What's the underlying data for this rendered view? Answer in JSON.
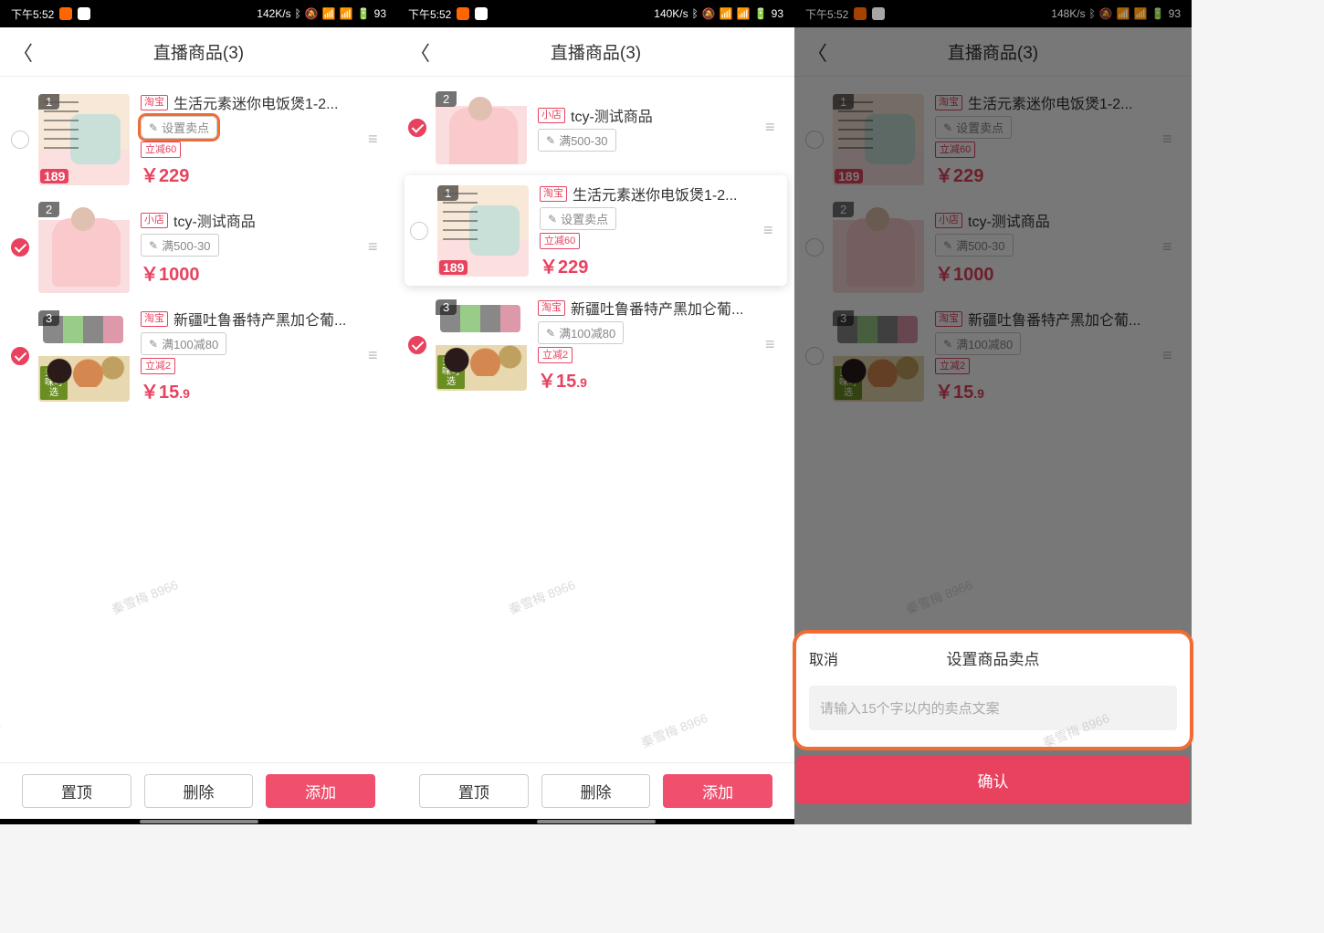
{
  "status": {
    "time": "下午5:52",
    "net1": "142K/s",
    "net2": "140K/s",
    "net3": "148K/s",
    "battery": "93"
  },
  "header": {
    "title": "直播商品(3)"
  },
  "products": {
    "p1": {
      "num": "1",
      "store": "淘宝",
      "name": "生活元素迷你电饭煲1-2...",
      "sell": "设置卖点",
      "discount": "立减60",
      "price": "￥229",
      "imgPrice": "189"
    },
    "p2": {
      "num": "2",
      "store": "小店",
      "name": "tcy-测试商品",
      "sell": "满500-30",
      "price": "￥1000"
    },
    "p3": {
      "num": "3",
      "store": "淘宝",
      "name": "新疆吐鲁番特产黑加仑葡...",
      "sell": "满100减80",
      "discount": "立减2",
      "price_int": "￥15",
      "price_dec": ".9",
      "corner": "多口味可选"
    }
  },
  "footer": {
    "top": "置顶",
    "delete": "删除",
    "add": "添加"
  },
  "sheet": {
    "cancel": "取消",
    "title": "设置商品卖点",
    "placeholder": "请输入15个字以内的卖点文案",
    "confirm": "确认"
  },
  "watermark": "秦雪梅 8966"
}
